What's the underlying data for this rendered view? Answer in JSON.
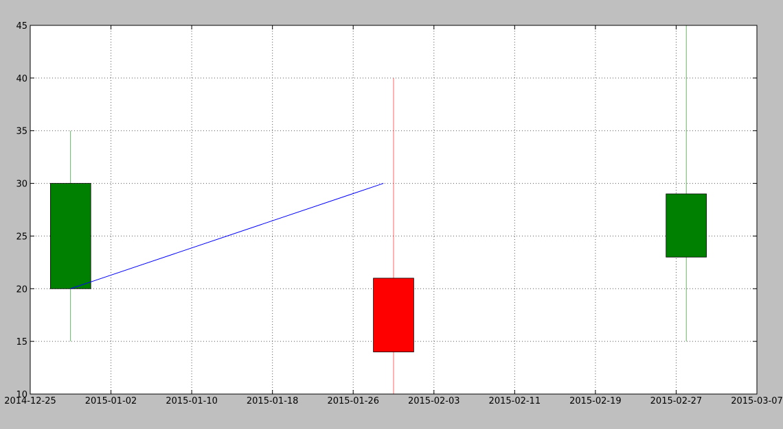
{
  "chart_data": {
    "type": "candlestick",
    "title": "",
    "xlabel": "",
    "ylabel": "",
    "xlim": [
      "2014-12-25",
      "2015-03-07"
    ],
    "ylim": [
      10,
      45
    ],
    "grid": true,
    "x_ticks": [
      "2014-12-25",
      "2015-01-02",
      "2015-01-10",
      "2015-01-18",
      "2015-01-26",
      "2015-02-03",
      "2015-02-11",
      "2015-02-19",
      "2015-02-27",
      "2015-03-07"
    ],
    "y_ticks": [
      10,
      15,
      20,
      25,
      30,
      35,
      40,
      45
    ],
    "candles": [
      {
        "date": "2014-12-29",
        "open": 20,
        "close": 30,
        "low": 15,
        "high": 35,
        "color": "#008000"
      },
      {
        "date": "2015-01-30",
        "open": 21,
        "close": 14,
        "low": 10,
        "high": 40,
        "color": "#ff0000"
      },
      {
        "date": "2015-02-28",
        "open": 23,
        "close": 29,
        "low": 15,
        "high": 45,
        "color": "#008000"
      }
    ],
    "series": [
      {
        "type": "line",
        "color": "#0000ff",
        "x": [
          "2014-12-29",
          "2015-01-29"
        ],
        "y": [
          20,
          30
        ]
      }
    ]
  }
}
